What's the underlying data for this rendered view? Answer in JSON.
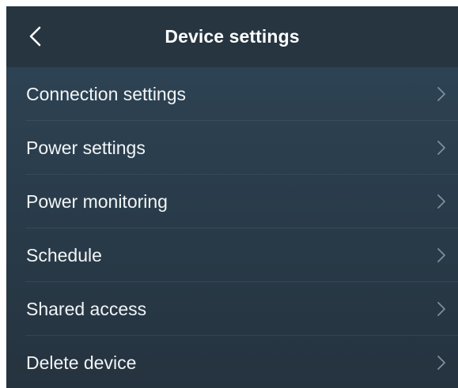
{
  "header": {
    "title": "Device settings",
    "back_icon": "chevron-left-icon"
  },
  "menu": {
    "items": [
      {
        "label": "Connection settings",
        "icon": "chevron-right-icon"
      },
      {
        "label": "Power settings",
        "icon": "chevron-right-icon"
      },
      {
        "label": "Power monitoring",
        "icon": "chevron-right-icon"
      },
      {
        "label": "Schedule",
        "icon": "chevron-right-icon"
      },
      {
        "label": "Shared access",
        "icon": "chevron-right-icon"
      },
      {
        "label": "Delete device",
        "icon": "chevron-right-icon"
      }
    ]
  },
  "colors": {
    "header_bg": "#263540",
    "body_bg": "#2f4556",
    "text": "#f2f5f7",
    "chevron": "#7d8f9c"
  }
}
